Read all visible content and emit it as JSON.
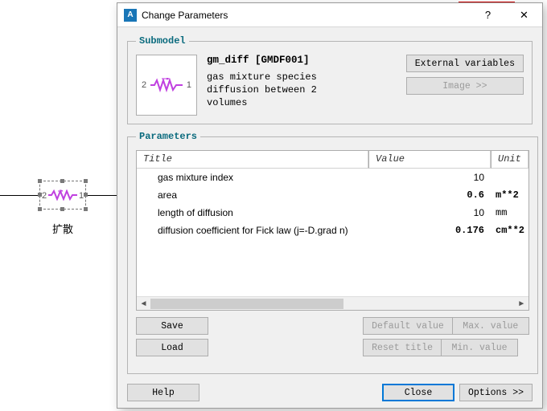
{
  "canvas": {
    "block_label": "扩散",
    "port_left": "2",
    "port_right": "1"
  },
  "dialog": {
    "title": "Change Parameters",
    "help_glyph": "?",
    "close_glyph": "✕"
  },
  "submodel": {
    "legend": "Submodel",
    "name": "gm_diff [GMDF001]",
    "desc_line1": "gas mixture species",
    "desc_line2": "diffusion between 2",
    "desc_line3": "volumes",
    "thumb_port_left": "2",
    "thumb_port_right": "1",
    "btn_external": "External variables",
    "btn_image": "Image >>"
  },
  "parameters": {
    "legend": "Parameters",
    "columns": {
      "title": "Title",
      "value": "Value",
      "unit": "Unit"
    },
    "rows": [
      {
        "title": "gas mixture index",
        "value": "10",
        "unit": "",
        "bold": false
      },
      {
        "title": "area",
        "value": "0.6",
        "unit": "m**2",
        "bold": true
      },
      {
        "title": "length of diffusion",
        "value": "10",
        "unit": "mm",
        "bold": false
      },
      {
        "title": "diffusion coefficient for Fick law (j=-D.grad n)",
        "value": "0.176",
        "unit": "cm**2",
        "bold": true
      }
    ],
    "btn_save": "Save",
    "btn_load": "Load",
    "btn_default": "Default value",
    "btn_max": "Max. value",
    "btn_reset": "Reset title",
    "btn_min": "Min. value"
  },
  "footer": {
    "help": "Help",
    "close": "Close",
    "options": "Options >>"
  },
  "scroll": {
    "left_glyph": "◄",
    "right_glyph": "►"
  }
}
